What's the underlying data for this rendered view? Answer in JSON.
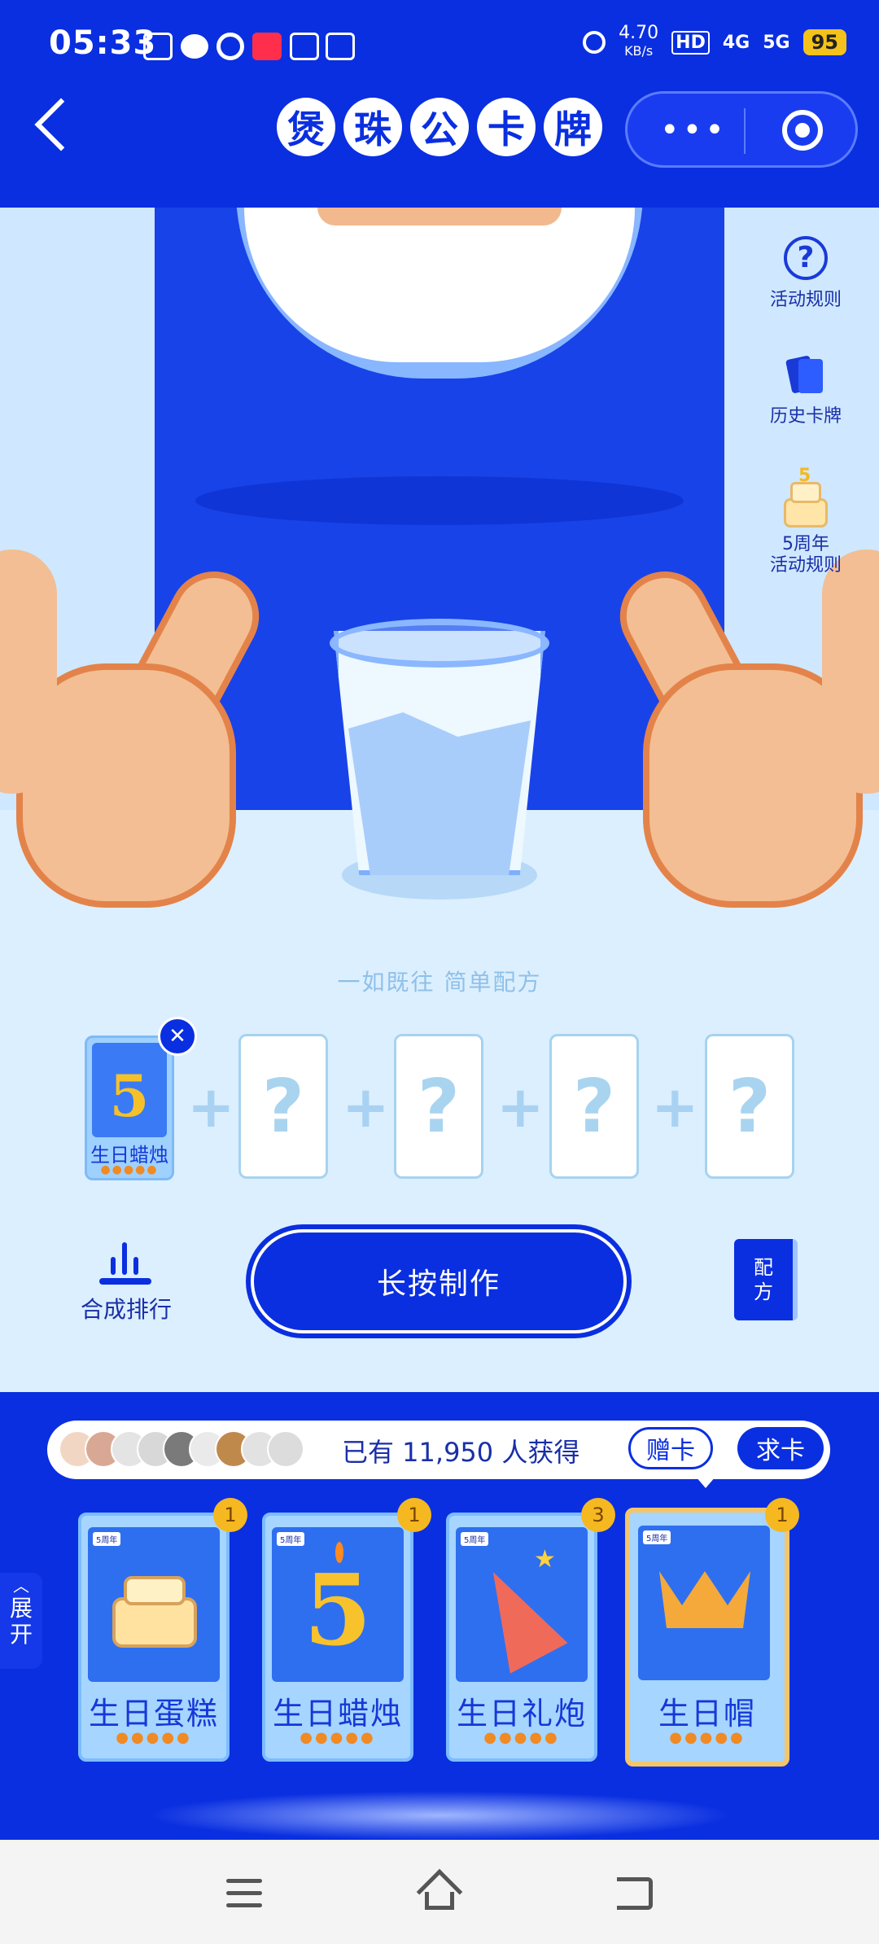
{
  "status_bar": {
    "time": "05:33",
    "net_speed": "4.70",
    "net_unit": "KB/s",
    "hd_label": "HD",
    "signal1": "4G",
    "signal2": "5G",
    "battery": "95"
  },
  "header": {
    "title_chars": [
      "煲",
      "珠",
      "公",
      "卡",
      "牌"
    ]
  },
  "side_menu": {
    "rules_label": "活动规则",
    "history_label": "历史卡牌",
    "anniv_rules_label": "5周年\n活动规则"
  },
  "scene": {
    "slogan": "一如既往 简单配方"
  },
  "synthesis": {
    "slot_card_name": "生日蜡烛",
    "slot_card_number": "5",
    "empty_slot_glyph": "?",
    "plus_glyph": "+"
  },
  "actions": {
    "rank_label": "合成排行",
    "make_button": "长按制作",
    "recipe_label": "配\n方"
  },
  "obtain_bar": {
    "text": "已有 11,950 人获得",
    "gift_button": "赠卡",
    "ask_button": "求卡"
  },
  "cards": [
    {
      "name": "生日蛋糕",
      "count": "1",
      "tag": "5周年",
      "icon": "cake-icon"
    },
    {
      "name": "生日蜡烛",
      "count": "1",
      "tag": "5周年",
      "icon": "candle-5-icon"
    },
    {
      "name": "生日礼炮",
      "count": "3",
      "tag": "5周年",
      "icon": "party-popper-icon"
    },
    {
      "name": "生日帽",
      "count": "1",
      "tag": "5周年",
      "icon": "crown-hat-icon"
    }
  ],
  "expand_tab": "展\n开",
  "colors": {
    "brand_blue": "#0a2fe0",
    "light_bg": "#dcefff",
    "badge_gold": "#f5b820"
  }
}
